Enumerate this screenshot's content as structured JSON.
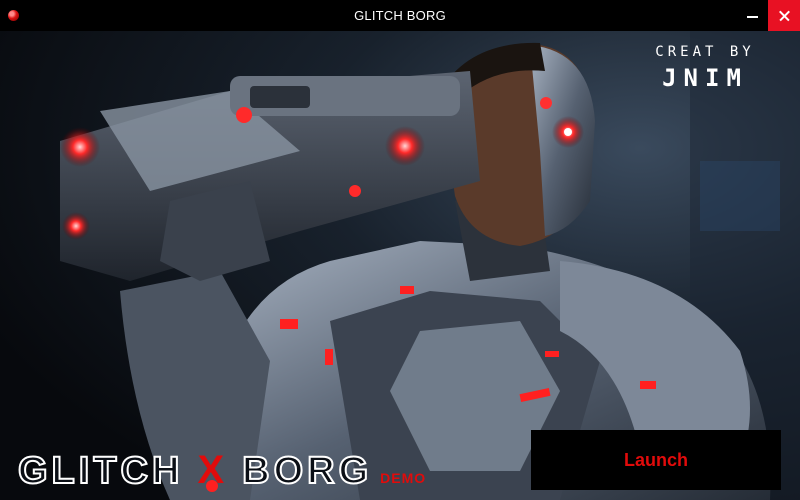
{
  "window": {
    "title": "GLITCH BORG",
    "app_icon": "red-orb-icon",
    "controls": {
      "minimize_icon": "minimize-icon",
      "close_icon": "close-icon",
      "close_color": "#e81123"
    }
  },
  "hero": {
    "credit_line": "CREAT BY",
    "credit_name": "JNIM",
    "logo_left": "GLITCH",
    "logo_x": "X",
    "logo_right": "BORG",
    "logo_tag": "DEMO"
  },
  "launch_button": {
    "label": "Launch",
    "text_color": "#e10b0b"
  },
  "colors": {
    "accent_red": "#e10b0b",
    "titlebar": "#000000",
    "armor": "#5a6474"
  }
}
